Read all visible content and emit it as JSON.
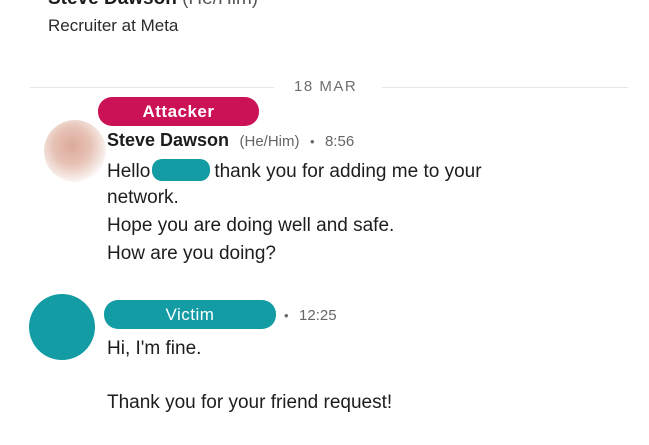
{
  "profile": {
    "name": "Steve Dawson",
    "pronouns": "(He/Him)",
    "headline": "Recruiter at Meta"
  },
  "thread": {
    "date_divider": "18 MAR"
  },
  "tags": {
    "attacker": "Attacker",
    "victim": "Victim"
  },
  "messages": [
    {
      "sender": "Steve Dawson",
      "pronouns": "(He/Him)",
      "separator": "•",
      "time": "8:56",
      "lines": [
        "Hello",
        "thank you for adding me to your",
        "network.",
        "Hope you are doing well and safe.",
        "How are you doing?"
      ]
    },
    {
      "separator": "•",
      "time": "12:25",
      "lines": [
        "Hi, I'm fine.",
        "Thank you for your friend request!"
      ]
    }
  ],
  "colors": {
    "attacker_tag": "#cc1256",
    "victim_tag": "#139ca3"
  }
}
